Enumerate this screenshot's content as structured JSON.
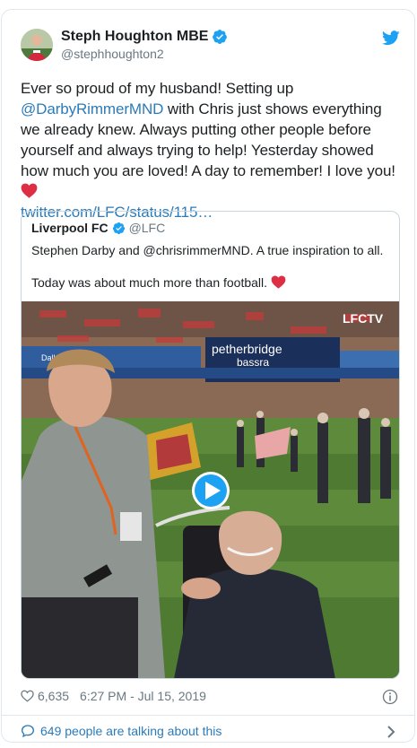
{
  "tweet": {
    "author_name": "Steph Houghton MBE",
    "author_handle": "@stephhoughton2",
    "text_part1": "Ever so proud of my husband! Setting up ",
    "mention": "@DarbyRimmerMND",
    "text_part2": " with Chris just shows everything we already knew. Always putting other people before yourself and always trying to help! Yesterday showed how much you are loved! A day to remember! I love you! ",
    "link": "twitter.com/LFC/status/115…",
    "likes": "6,635",
    "timestamp": "6:27 PM - Jul 15, 2019",
    "talking": "649 people are talking about this"
  },
  "quoted": {
    "author_name": "Liverpool FC",
    "author_handle": "@LFC",
    "line1": "Stephen Darby and @chrisrimmerMND. A true inspiration to all.",
    "line2": "Today was about much more than football. ",
    "watermark": "LFCTV",
    "board_title": "petherbridge",
    "board_sub": "bassra"
  },
  "colors": {
    "link": "#2b7bb9",
    "verified": "#1da1f2",
    "heart": "#e0245e",
    "secondary_text": "#697882"
  },
  "icons": [
    "verified-icon",
    "twitter-bird-icon",
    "heart-emoji-icon",
    "play-icon",
    "heart-outline-icon",
    "info-icon",
    "speech-bubble-icon",
    "chevron-right-icon"
  ]
}
